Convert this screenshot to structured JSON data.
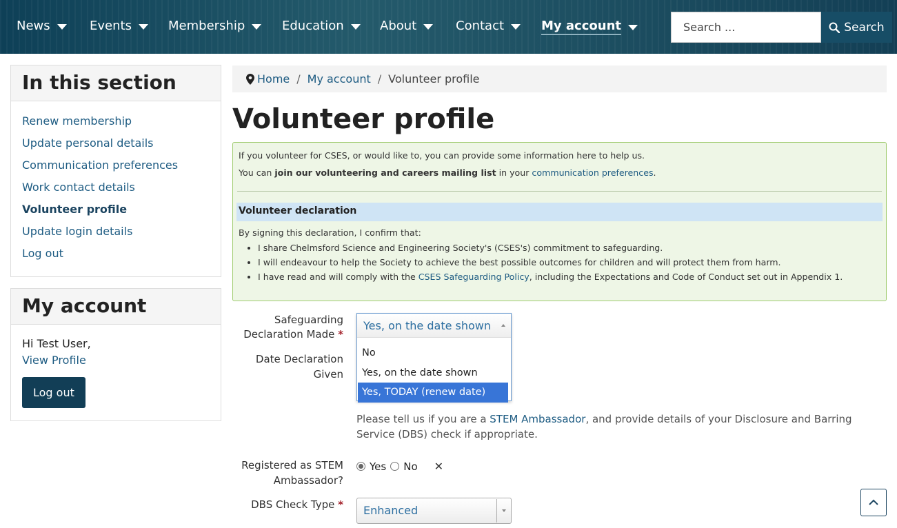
{
  "nav": {
    "items": [
      {
        "label": "News"
      },
      {
        "label": "Events"
      },
      {
        "label": "Membership"
      },
      {
        "label": "Education"
      },
      {
        "label": "About"
      },
      {
        "label": "Contact"
      },
      {
        "label": "My account",
        "active": true
      }
    ],
    "search_placeholder": "Search ...",
    "search_button": "Search"
  },
  "sidebar": {
    "section_title": "In this section",
    "links": [
      {
        "label": "Renew membership"
      },
      {
        "label": "Update personal details"
      },
      {
        "label": "Communication preferences"
      },
      {
        "label": "Work contact details"
      },
      {
        "label": "Volunteer profile",
        "current": true
      },
      {
        "label": "Update login details"
      },
      {
        "label": "Log out"
      }
    ],
    "account_title": "My account",
    "greeting": "Hi Test User,",
    "view_profile": "View Profile",
    "logout_button": "Log out"
  },
  "breadcrumb": {
    "home": "Home",
    "my_account": "My account",
    "current": "Volunteer profile",
    "separator": "/"
  },
  "page": {
    "title": "Volunteer profile"
  },
  "info": {
    "line1": "If you volunteer for CSES, or would like to, you can provide some information here to help us.",
    "line2_pre": "You can ",
    "line2_bold": "join our volunteering and careers mailing list",
    "line2_mid": " in your ",
    "line2_link": "communication preferences",
    "line2_post": ".",
    "declaration_heading": "Volunteer declaration",
    "declaration_intro": "By signing this declaration, I confirm that:",
    "bullet1": "I share Chelmsford Science and Engineering Society's (CSES's) commitment to safeguarding.",
    "bullet2": "I will endeavour to help the Society to achieve the best possible outcomes for children and will protect them from harm.",
    "bullet3_pre": "I have read and will comply with the ",
    "bullet3_link": "CSES Safeguarding Policy",
    "bullet3_post": ", including the Expectations and Code of Conduct set out in Appendix 1."
  },
  "form": {
    "safeguarding_label_1": "Safeguarding",
    "safeguarding_label_2": "Declaration Made",
    "required_mark": "*",
    "safeguarding_selected": "Yes, on the date shown",
    "safeguarding_options": [
      "No",
      "Yes, on the date shown",
      "Yes, TODAY (renew date)"
    ],
    "date_label_1": "Date Declaration",
    "date_label_2": "Given",
    "hint_pre": "Please tell us if you are a ",
    "hint_link": "STEM Ambassador",
    "hint_post": ", and provide details of your Disclosure and Barring Service (DBS) check if appropriate.",
    "stem_label_1": "Registered as STEM",
    "stem_label_2": "Ambassador?",
    "stem_yes": "Yes",
    "stem_no": "No",
    "stem_value": "Yes",
    "clear_symbol": "✕",
    "dbs_label": "DBS Check Type",
    "dbs_value": "Enhanced"
  },
  "colors": {
    "nav_bg": "#174d66",
    "link": "#1d5b82",
    "info_bg": "#eef6e6",
    "info_border": "#9fcb6e",
    "declaration_bg": "#cfe4f5",
    "highlight": "#3875d7",
    "button_dark": "#123e56"
  },
  "icons": {
    "map_marker": "map-marker-icon",
    "search": "search-icon",
    "caret": "caret-down-icon",
    "back_to_top": "chevron-up-icon"
  }
}
